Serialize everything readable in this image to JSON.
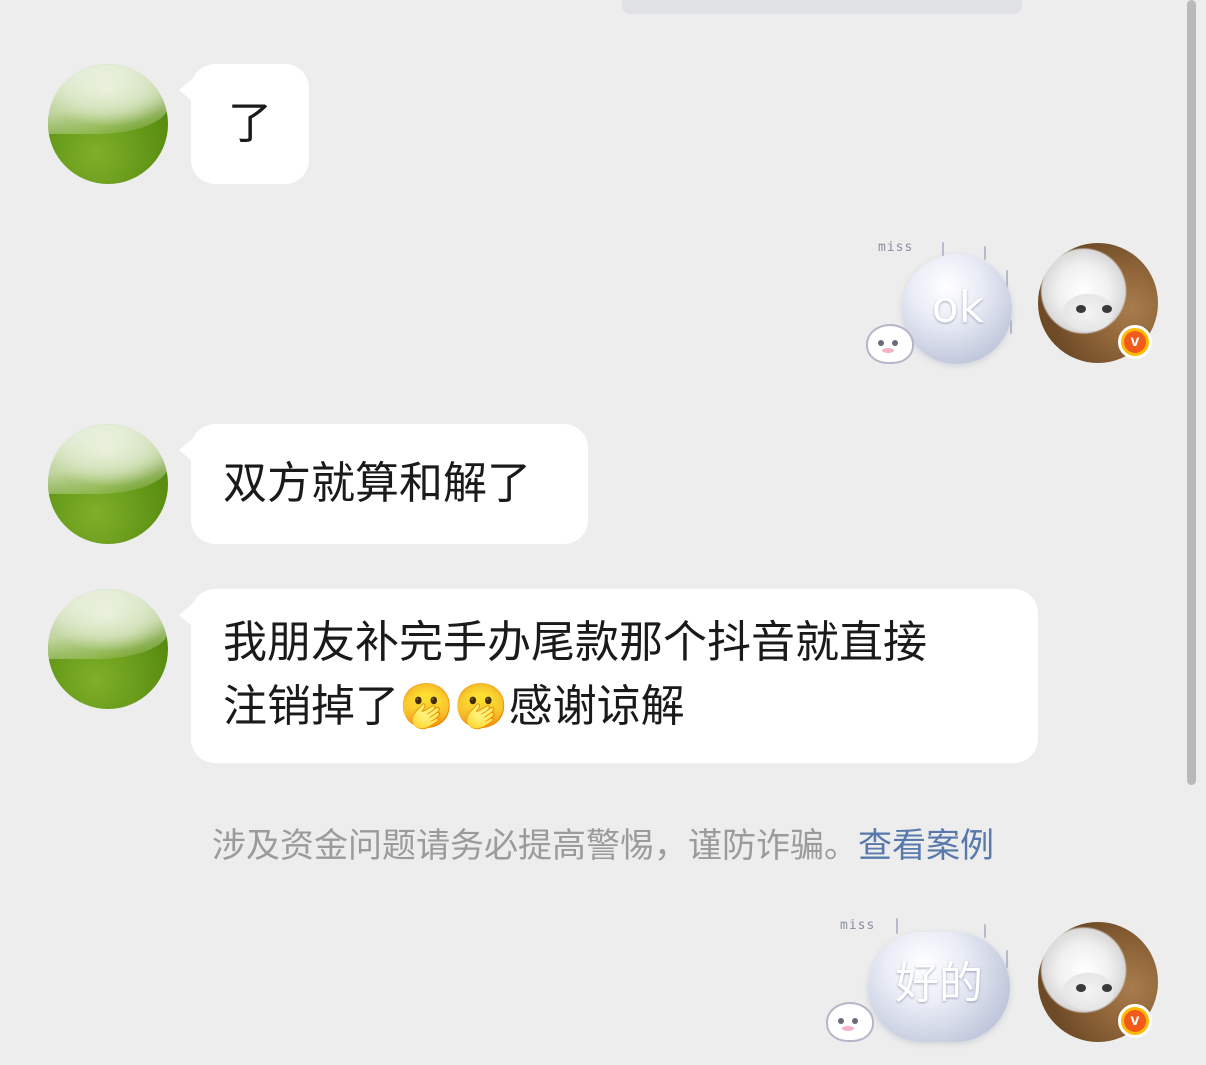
{
  "messages": [
    {
      "side": "left",
      "text": "了"
    },
    {
      "side": "right",
      "text": "ok",
      "caption": "miss"
    },
    {
      "side": "left",
      "text": "双方就算和解了"
    },
    {
      "side": "left",
      "text": "我朋友补完手办尾款那个抖音就直接\n注销掉了🫢🫢感谢谅解"
    },
    {
      "side": "right",
      "text": "好的",
      "caption": "miss"
    }
  ],
  "notice": {
    "text": "涉及资金问题请务必提高警惕，谨防诈骗。",
    "link": "查看案例"
  },
  "badge": {
    "label": "v"
  },
  "icons": {
    "left_avatar": "green-avatar",
    "right_avatar": "kitten-avatar",
    "badge": "verified-v-badge"
  },
  "colors": {
    "background": "#ededed",
    "bubble": "#ffffff",
    "link": "#5779ac",
    "notice": "#9b9b9b"
  }
}
